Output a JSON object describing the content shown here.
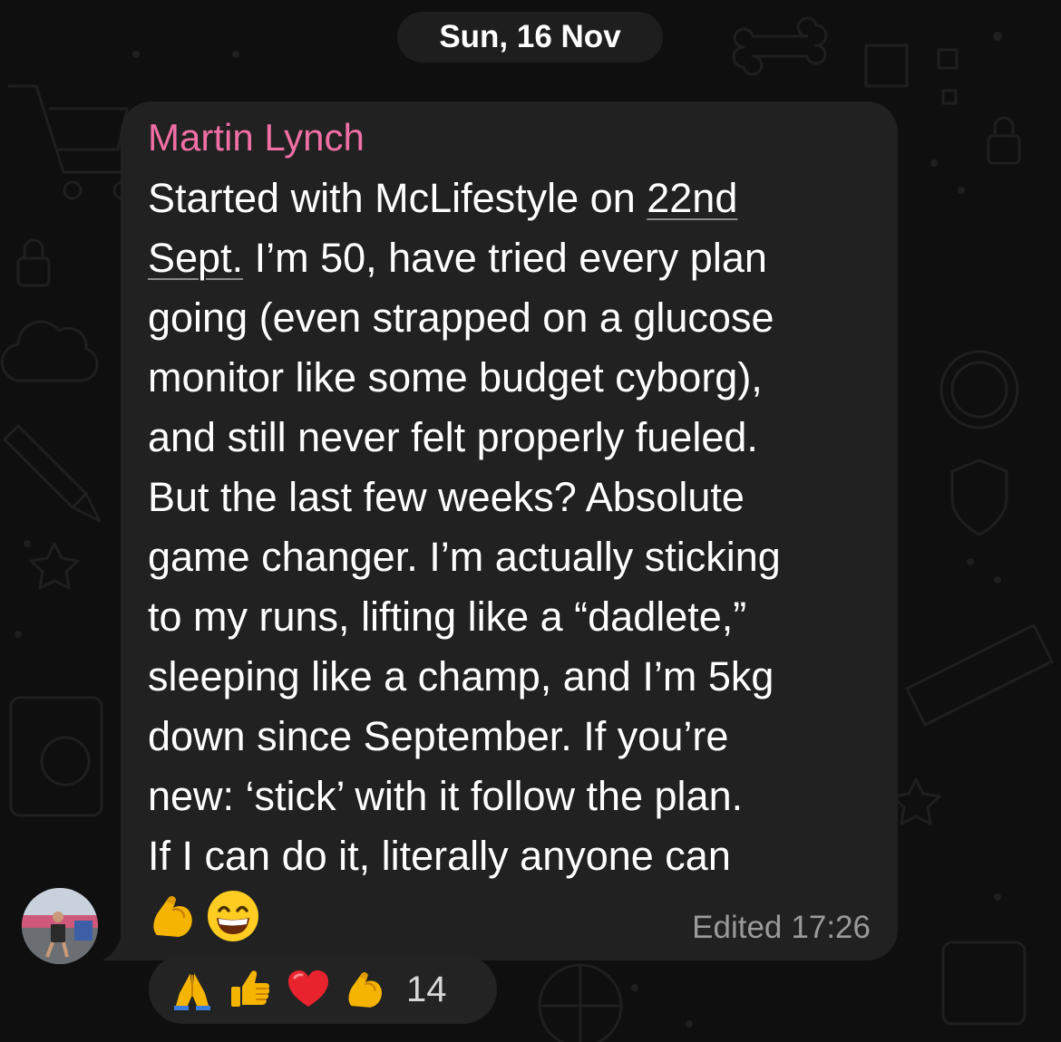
{
  "chat": {
    "date_separator": "Sun, 16 Nov"
  },
  "message": {
    "sender": "Martin Lynch",
    "lines": [
      "Started with McLifestyle  on ",
      "I’m 50, have tried every plan",
      "going (even strapped on a glucose",
      "monitor like some budget cyborg),",
      "and still never felt properly fueled.",
      "But the last few weeks? Absolute",
      "game changer. I’m actually sticking",
      "to my runs, lifting like a “dadlete,”",
      "sleeping like a champ, and I’m 5kg",
      "down since September. If you’re",
      "new: ‘stick’ with it follow the plan.",
      "If I can do it, literally anyone can"
    ],
    "date_link_part1": "22nd",
    "date_link_part2": "Sept.",
    "trailing_emojis": [
      "flexed-biceps",
      "grinning-face-with-smiling-eyes"
    ],
    "edited_label": "Edited",
    "time": "17:26"
  },
  "reactions": {
    "emojis": [
      "folded-hands",
      "thumbs-up",
      "red-heart",
      "flexed-biceps"
    ],
    "count": "14"
  },
  "colors": {
    "sender_name": "#f06fa5",
    "bubble": "#212121",
    "background": "#0f0f0f",
    "meta_text": "#9a9a9a"
  }
}
